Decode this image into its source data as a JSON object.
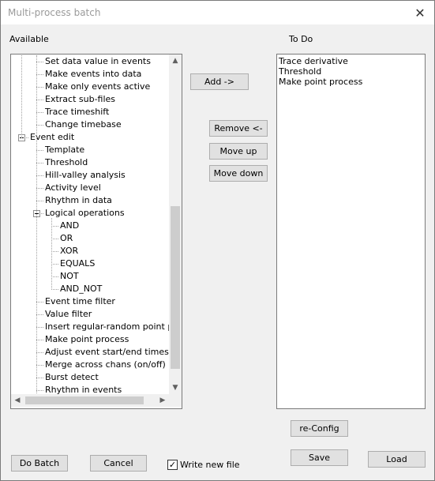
{
  "window": {
    "title": "Multi-process batch",
    "close_glyph": "✕"
  },
  "available": {
    "label": "Available",
    "items": [
      {
        "text": "Set data value in events",
        "level": 1
      },
      {
        "text": "Make events into data",
        "level": 1
      },
      {
        "text": "Make only events active",
        "level": 1
      },
      {
        "text": "Extract sub-files",
        "level": 1
      },
      {
        "text": "Trace timeshift",
        "level": 1
      },
      {
        "text": "Change timebase",
        "level": 1
      },
      {
        "text": "Event edit",
        "level": 0,
        "expanded": true
      },
      {
        "text": "Template",
        "level": 1
      },
      {
        "text": "Threshold",
        "level": 1
      },
      {
        "text": "Hill-valley analysis",
        "level": 1
      },
      {
        "text": "Activity level",
        "level": 1
      },
      {
        "text": "Rhythm in data",
        "level": 1
      },
      {
        "text": "Logical operations",
        "level": 1,
        "expanded": true
      },
      {
        "text": "AND",
        "level": 2
      },
      {
        "text": "OR",
        "level": 2
      },
      {
        "text": "XOR",
        "level": 2
      },
      {
        "text": "EQUALS",
        "level": 2
      },
      {
        "text": "NOT",
        "level": 2
      },
      {
        "text": "AND_NOT",
        "level": 2
      },
      {
        "text": "Event time filter",
        "level": 1
      },
      {
        "text": "Value filter",
        "level": 1
      },
      {
        "text": "Insert regular-random point process",
        "level": 1
      },
      {
        "text": "Make point process",
        "level": 1
      },
      {
        "text": "Adjust event start/end times",
        "level": 1
      },
      {
        "text": "Merge across chans (on/off)",
        "level": 1
      },
      {
        "text": "Burst detect",
        "level": 1
      },
      {
        "text": "Rhythm in events",
        "level": 1
      }
    ]
  },
  "todo": {
    "label": "To Do",
    "items": [
      "Trace derivative",
      "Threshold",
      "Make point process"
    ]
  },
  "buttons": {
    "add": "Add ->",
    "remove": "Remove <-",
    "move_up": "Move up",
    "move_down": "Move down",
    "reconfig": "re-Config",
    "do_batch": "Do Batch",
    "cancel": "Cancel",
    "save": "Save",
    "load": "Load"
  },
  "write_new_file": {
    "label": "Write new file",
    "checked": true,
    "check_glyph": "✓"
  },
  "scroll": {
    "up": "▲",
    "down": "▼",
    "left": "◀",
    "right": "▶"
  }
}
